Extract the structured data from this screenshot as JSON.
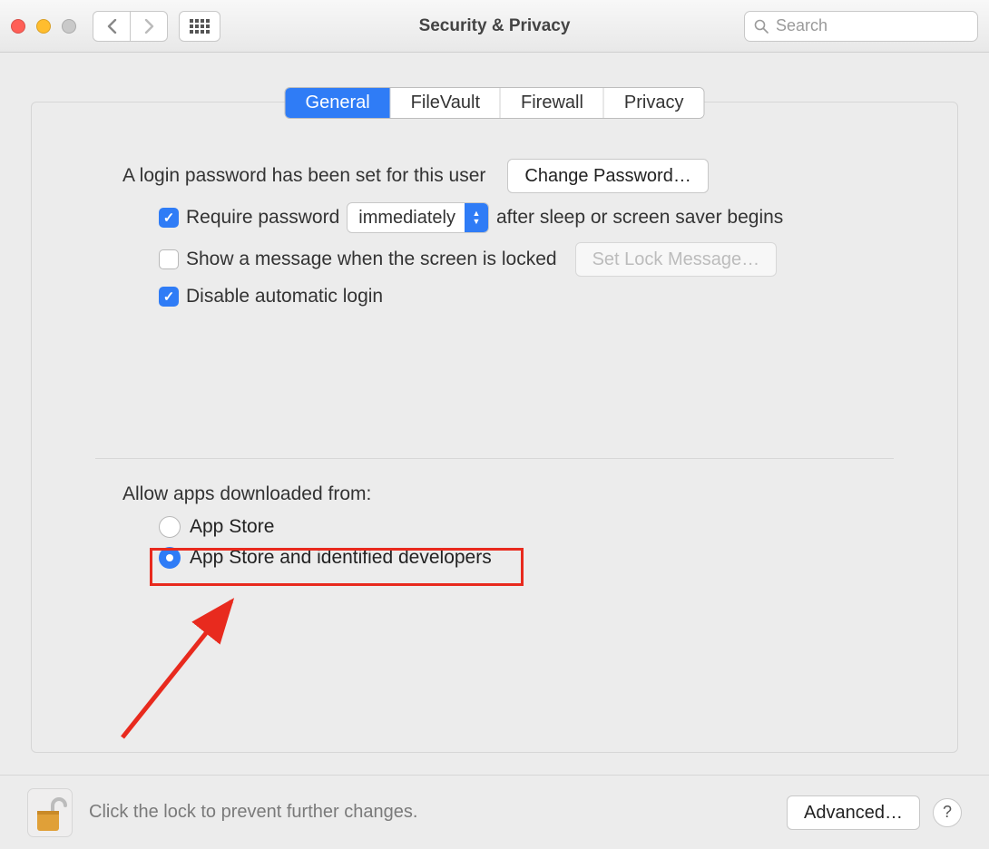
{
  "window": {
    "title": "Security & Privacy"
  },
  "search": {
    "placeholder": "Search"
  },
  "tabs": [
    {
      "label": "General",
      "active": true
    },
    {
      "label": "FileVault",
      "active": false
    },
    {
      "label": "Firewall",
      "active": false
    },
    {
      "label": "Privacy",
      "active": false
    }
  ],
  "login": {
    "password_set_msg": "A login password has been set for this user",
    "change_password_btn": "Change Password…",
    "require_pw_label_before": "Require password",
    "require_pw_dropdown": "immediately",
    "require_pw_label_after": "after sleep or screen saver begins",
    "require_pw_checked": true,
    "show_msg_label": "Show a message when the screen is locked",
    "show_msg_checked": false,
    "set_lock_msg_btn": "Set Lock Message…",
    "set_lock_msg_enabled": false,
    "disable_auto_login_label": "Disable automatic login",
    "disable_auto_login_checked": true
  },
  "gatekeeper": {
    "heading": "Allow apps downloaded from:",
    "options": [
      {
        "label": "App Store",
        "selected": false
      },
      {
        "label": "App Store and identified developers",
        "selected": true
      }
    ]
  },
  "footer": {
    "hint": "Click the lock to prevent further changes.",
    "advanced_btn": "Advanced…",
    "help": "?"
  }
}
